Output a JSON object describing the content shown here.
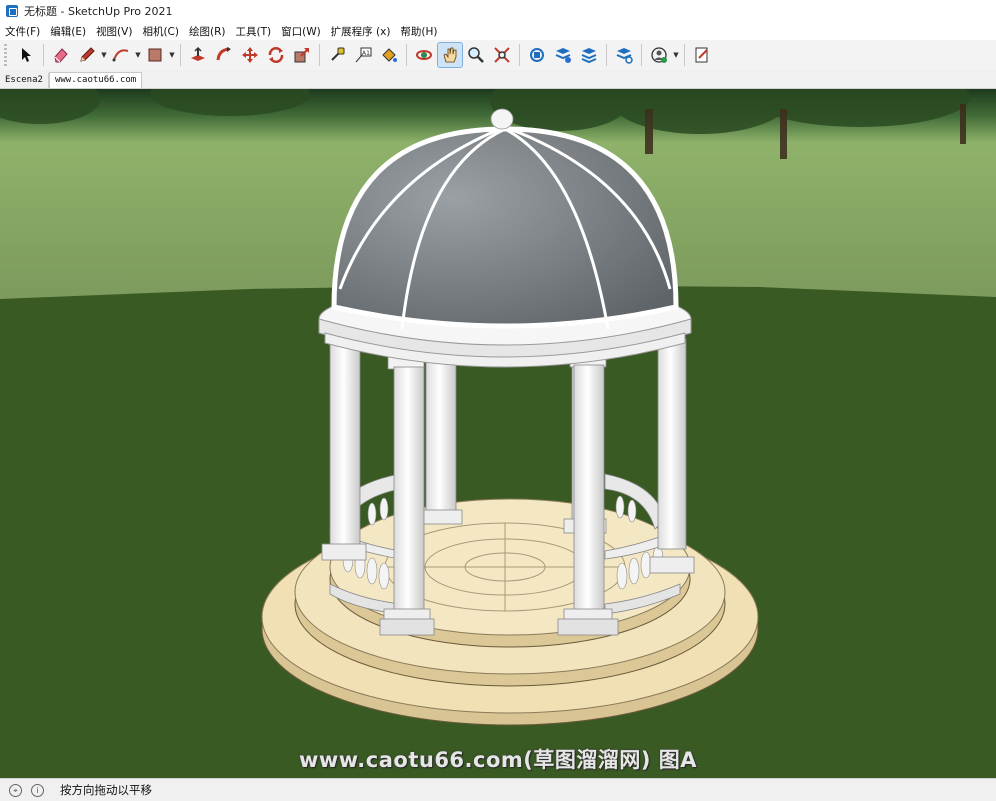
{
  "window": {
    "title": "无标题 - SketchUp Pro 2021"
  },
  "menu": [
    {
      "label": "文件(F)"
    },
    {
      "label": "编辑(E)"
    },
    {
      "label": "视图(V)"
    },
    {
      "label": "相机(C)"
    },
    {
      "label": "绘图(R)"
    },
    {
      "label": "工具(T)"
    },
    {
      "label": "窗口(W)"
    },
    {
      "label": "扩展程序 (x)"
    },
    {
      "label": "帮助(H)"
    }
  ],
  "toolbar": {
    "tools": [
      {
        "icon": "select-arrow-icon"
      },
      {
        "icon": "eraser-icon"
      },
      {
        "icon": "pencil-icon"
      },
      {
        "icon": "arc-icon"
      },
      {
        "icon": "rectangle-shape-icon"
      },
      {
        "icon": "push-pull-icon"
      },
      {
        "icon": "follow-me-icon"
      },
      {
        "icon": "move-icon"
      },
      {
        "icon": "rotate-icon"
      },
      {
        "icon": "scale-icon"
      },
      {
        "icon": "tape-measure-icon"
      },
      {
        "icon": "text-icon"
      },
      {
        "icon": "paint-bucket-icon"
      },
      {
        "icon": "orbit-icon"
      },
      {
        "icon": "pan-icon"
      },
      {
        "icon": "zoom-icon"
      },
      {
        "icon": "zoom-extents-icon"
      },
      {
        "icon": "warehouse-icon"
      },
      {
        "icon": "extension-warehouse-icon"
      },
      {
        "icon": "layout-send-icon"
      },
      {
        "icon": "extension-manager-icon"
      },
      {
        "icon": "account-icon"
      },
      {
        "icon": "tray-icon"
      }
    ],
    "active_tool": "pan-icon"
  },
  "scenes": [
    {
      "label": "Escena2"
    },
    {
      "label": "www.caotu66.com"
    }
  ],
  "viewport": {
    "watermark": "www.caotu66.com(草图溜溜网) 图A"
  },
  "status": {
    "text": "按方向拖动以平移"
  },
  "colors": {
    "ground": "#3a5a24",
    "dome": "#7d8388",
    "column": "#f2f2f2",
    "floor": "#e8d6a8"
  }
}
